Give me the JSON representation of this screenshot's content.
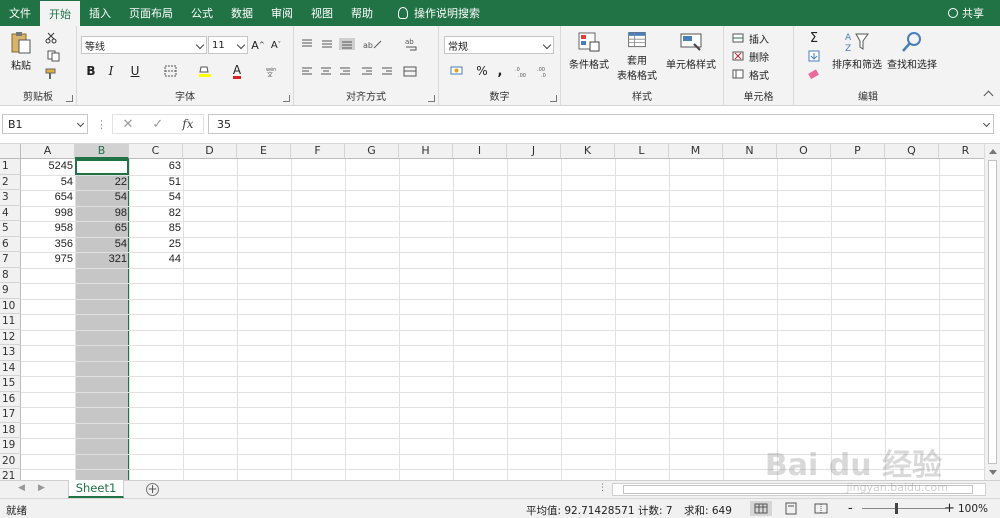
{
  "tabs": [
    "文件",
    "开始",
    "插入",
    "页面布局",
    "公式",
    "数据",
    "审阅",
    "视图",
    "帮助"
  ],
  "active_tab_index": 1,
  "tell_me": "操作说明搜索",
  "share": "共享",
  "ribbon": {
    "clipboard": {
      "paste": "粘贴",
      "label": "剪贴板"
    },
    "font": {
      "name": "等线",
      "size": "11",
      "bold": "B",
      "italic": "I",
      "underline": "U",
      "grow": "A",
      "shrink": "A",
      "font_color_letter": "A",
      "label": "字体"
    },
    "alignment": {
      "label": "对齐方式"
    },
    "number": {
      "format": "常规",
      "percent": "%",
      "comma": ",",
      "label": "数字"
    },
    "styles": {
      "conditional": "条件格式",
      "table_1": "套用",
      "table_2": "表格格式",
      "cell_styles": "单元格样式",
      "label": "样式"
    },
    "cells": {
      "insert": "插入",
      "delete": "删除",
      "format": "格式",
      "label": "单元格"
    },
    "editing": {
      "sum": "Σ",
      "sort": "排序和筛选",
      "find": "查找和选择",
      "label": "编辑"
    }
  },
  "formula_bar": {
    "name_box": "B1",
    "fx": "fx",
    "cancel": "✕",
    "enter": "✓",
    "value": "35"
  },
  "columns": [
    "A",
    "B",
    "C",
    "D",
    "E",
    "F",
    "G",
    "H",
    "I",
    "J",
    "K",
    "L",
    "M",
    "N",
    "O",
    "P",
    "Q",
    "R"
  ],
  "selected_column": "B",
  "rows": [
    "1",
    "2",
    "3",
    "4",
    "5",
    "6",
    "7",
    "8",
    "9",
    "10",
    "11",
    "12",
    "13",
    "14",
    "15",
    "16",
    "17",
    "18",
    "19",
    "20",
    "21"
  ],
  "cells": [
    [
      "5245",
      "35",
      "63"
    ],
    [
      "54",
      "22",
      "51"
    ],
    [
      "654",
      "54",
      "54"
    ],
    [
      "998",
      "98",
      "82"
    ],
    [
      "958",
      "65",
      "85"
    ],
    [
      "356",
      "54",
      "25"
    ],
    [
      "975",
      "321",
      "44"
    ]
  ],
  "sheet_tabs": [
    "Sheet1"
  ],
  "add_sheet": "+",
  "status": {
    "ready": "就绪",
    "average": "平均值: 92.71428571",
    "count": "计数: 7",
    "sum": "求和: 649",
    "zoom_minus": "-",
    "zoom_plus": "+",
    "zoom": "100%"
  },
  "watermark": {
    "main": "Bai du 经验",
    "sub": "jingyan.baidu.com"
  },
  "colors": {
    "accent": "#217346",
    "selection": "#c6c6c6"
  }
}
